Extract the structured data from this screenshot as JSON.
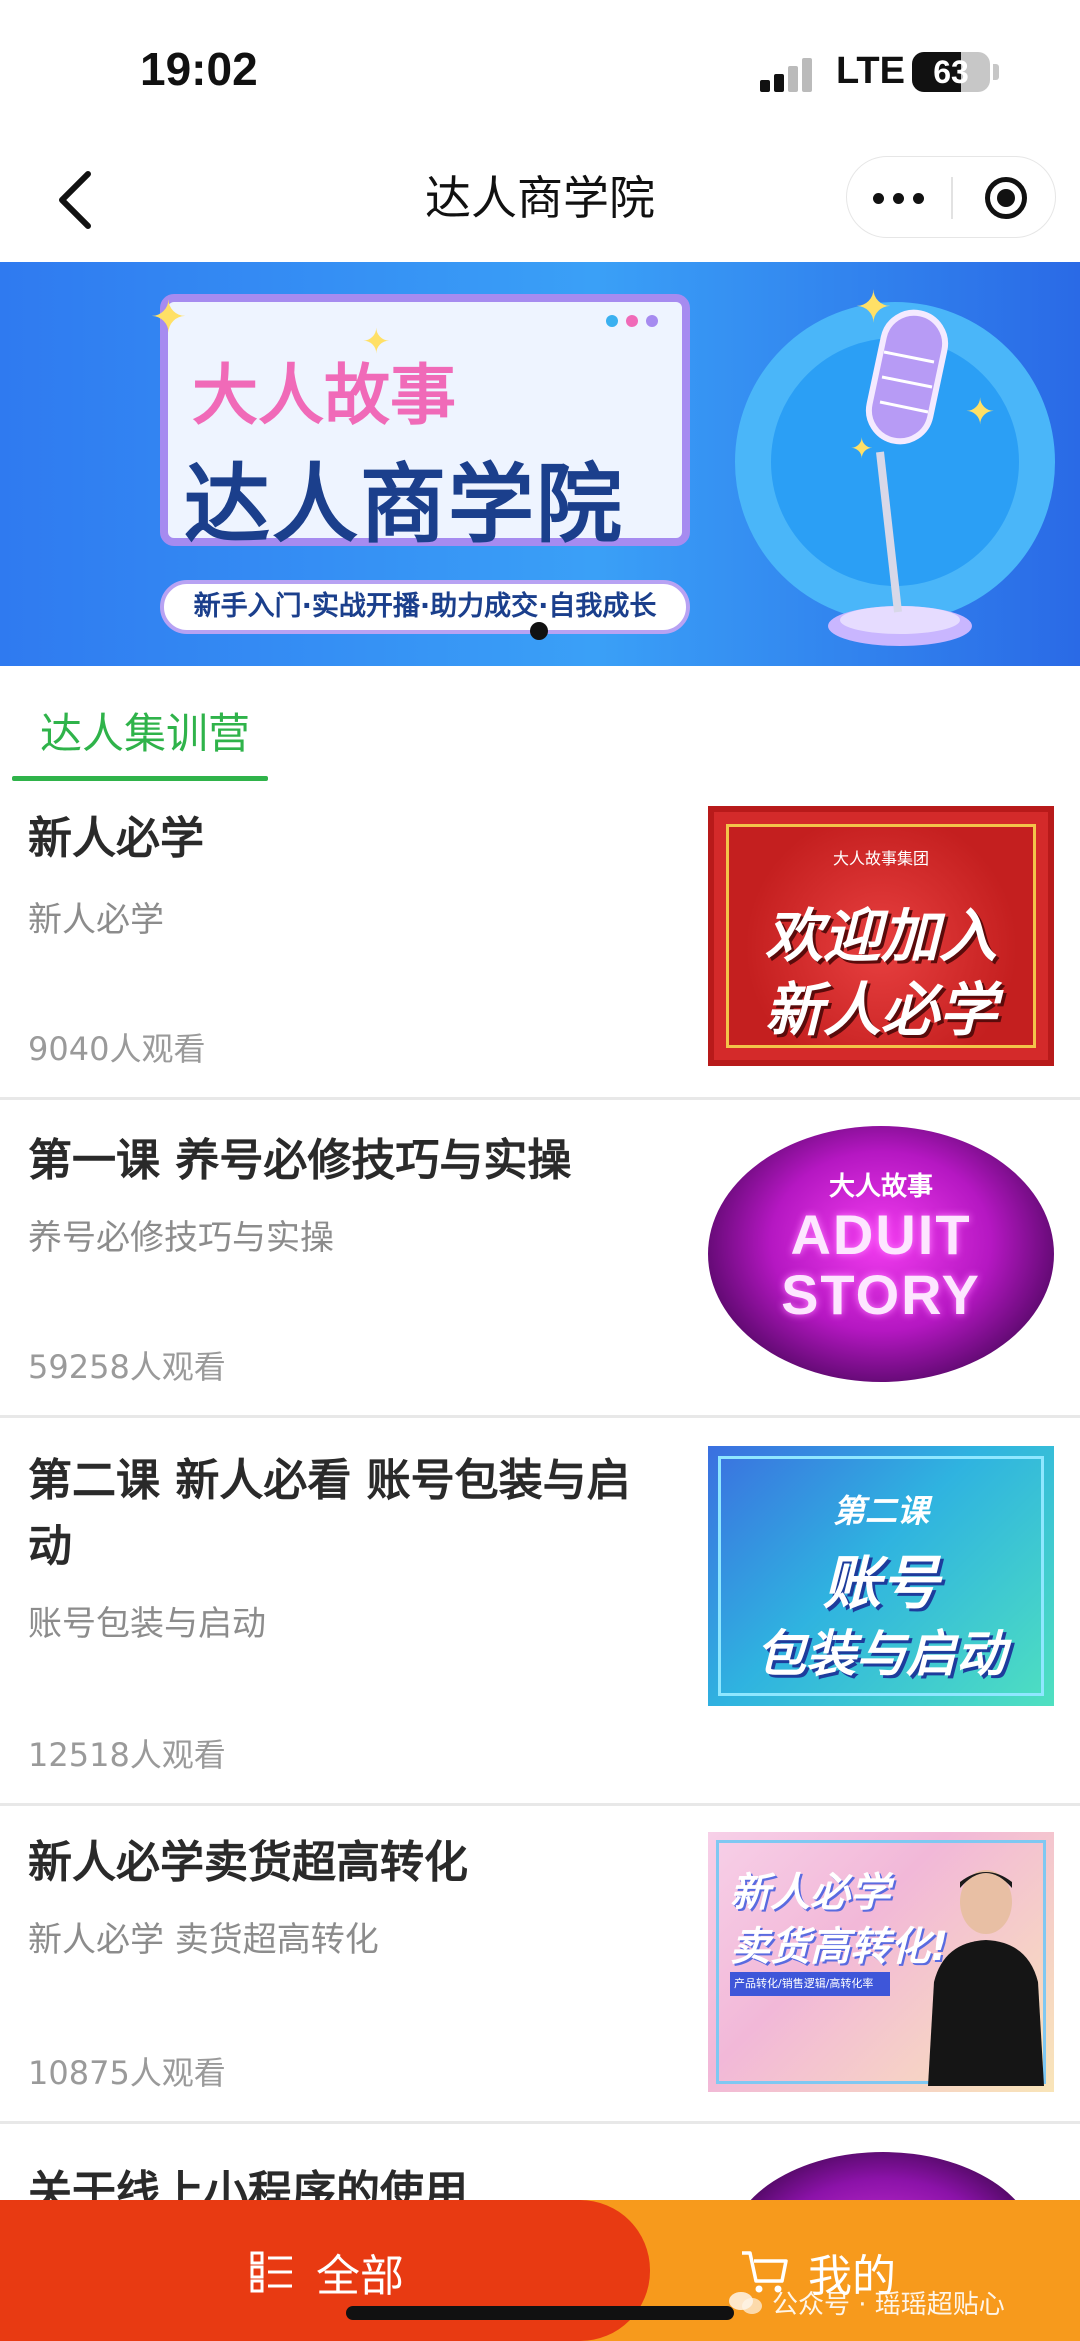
{
  "status_bar": {
    "time": "19:02",
    "network": "LTE",
    "battery": "63",
    "battery_level": 0.63
  },
  "nav": {
    "title": "达人商学院"
  },
  "banner": {
    "line1": "大人故事",
    "line2": "达人商学院",
    "tagline": "新手入门·实战开播·助力成交·自我成长"
  },
  "tabs": [
    {
      "label": "达人集训营",
      "active": true
    }
  ],
  "courses": [
    {
      "title": "新人必学",
      "subtitle": "新人必学",
      "views": "9040人观看",
      "thumb": {
        "brand": "大人故事集团",
        "line1": "欢迎加入",
        "line2": "新人必学"
      }
    },
    {
      "title": "第一课 养号必修技巧与实操",
      "subtitle": "养号必修技巧与实操",
      "views": "59258人观看",
      "thumb": {
        "small": "大人故事",
        "line1": "ADUIT",
        "line2": "STORY"
      }
    },
    {
      "title": "第二课 新人必看 账号包装与启动",
      "subtitle": "账号包装与启动",
      "views": "12518人观看",
      "thumb": {
        "line1": "第二课",
        "line2": "账号",
        "line3": "包装与启动"
      }
    },
    {
      "title": "新人必学卖货超高转化",
      "subtitle": "新人必学 卖货超高转化",
      "views": "10875人观看",
      "thumb": {
        "line1": "新人必学",
        "line2": "卖货高转化!",
        "bar": "产品转化/销售逻辑/高转化率"
      }
    },
    {
      "title": "关于线上小程序的使用"
    }
  ],
  "bottom_bar": {
    "all_label": "全部",
    "mine_label": "我的",
    "watermark": "公众号 · 瑶瑶超贴心"
  },
  "colors": {
    "accent_green": "#2fb34a",
    "tab_red": "#e83a12",
    "tab_orange": "#f79a1c"
  }
}
